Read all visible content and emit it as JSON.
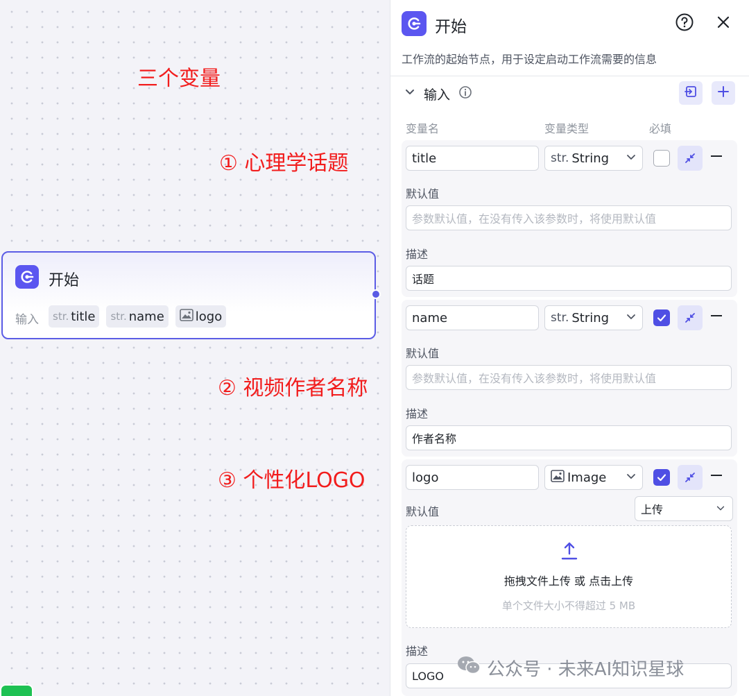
{
  "annotations": {
    "title": "三个变量",
    "item1": "① 心理学话题",
    "item2": "② 视频作者名称",
    "item3": "③ 个性化LOGO"
  },
  "start_node": {
    "title": "开始",
    "input_label": "输入",
    "tags": [
      {
        "prefix": "str.",
        "name": "title"
      },
      {
        "prefix": "str.",
        "name": "name"
      },
      {
        "prefix": "",
        "name": "logo",
        "icon": "image-icon"
      }
    ]
  },
  "panel": {
    "title": "开始",
    "description": "工作流的起始节点，用于设定启动工作流需要的信息",
    "section_title": "输入",
    "columns": {
      "name": "变量名",
      "type": "变量类型",
      "required": "必填"
    },
    "variables": [
      {
        "name": "title",
        "type_prefix": "str.",
        "type": "String",
        "required": false,
        "default_label": "默认值",
        "default_placeholder": "参数默认值，在没有传入该参数时，将使用默认值",
        "desc_label": "描述",
        "desc_value": "话题"
      },
      {
        "name": "name",
        "type_prefix": "str.",
        "type": "String",
        "required": true,
        "default_label": "默认值",
        "default_placeholder": "参数默认值，在没有传入该参数时，将使用默认值",
        "desc_label": "描述",
        "desc_value": "作者名称"
      },
      {
        "name": "logo",
        "type_prefix": "",
        "type": "Image",
        "required": true,
        "default_label": "默认值",
        "default_mode": "上传",
        "upload_text": "拖拽文件上传 或 点击上传",
        "upload_hint": "单个文件大小不得超过 5 MB",
        "desc_label": "描述",
        "desc_value": "LOGO"
      }
    ]
  },
  "watermark": "公众号 · 未来AI知识星球",
  "colors": {
    "accent": "#5b56f0",
    "annotation": "#f21d1d",
    "checkbox_on": "#4f4fe4"
  }
}
